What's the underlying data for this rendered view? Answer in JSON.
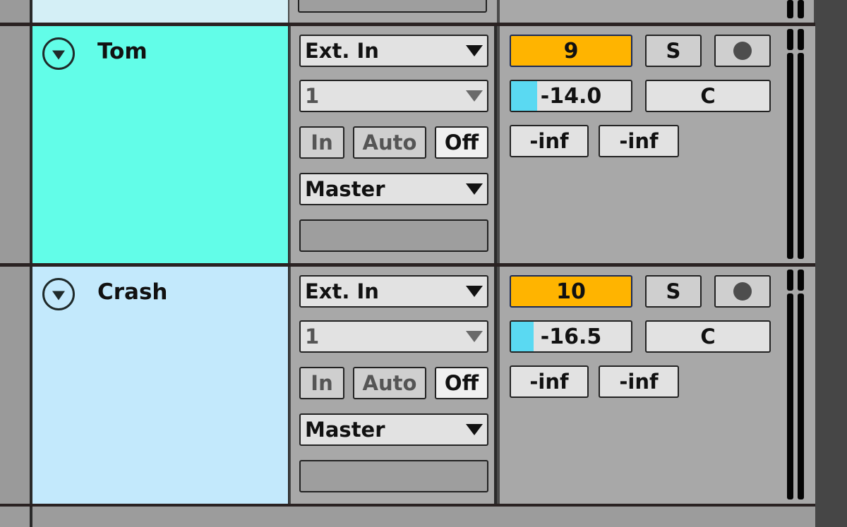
{
  "tracks_above": {
    "color": "#d4eff6"
  },
  "tracks": [
    {
      "name": "Tom",
      "color": "#62fde8",
      "input_type": "Ext. In",
      "input_channel": "1",
      "monitor": {
        "in": "In",
        "auto": "Auto",
        "off": "Off"
      },
      "output": "Master",
      "track_number": "9",
      "solo": "S",
      "volume": "-14.0",
      "volume_fraction": 0.22,
      "pan": "C",
      "send_a": "-inf",
      "send_b": "-inf"
    },
    {
      "name": "Crash",
      "color": "#c3e9fc",
      "input_type": "Ext. In",
      "input_channel": "1",
      "monitor": {
        "in": "In",
        "auto": "Auto",
        "off": "Off"
      },
      "output": "Master",
      "track_number": "10",
      "solo": "S",
      "volume": "-16.5",
      "volume_fraction": 0.19,
      "pan": "C",
      "send_a": "-inf",
      "send_b": "-inf"
    }
  ],
  "colors": {
    "track_number_bg": "#ffb400",
    "volume_fill": "#5ad9f2",
    "panel_bg": "#a8a8a8"
  }
}
